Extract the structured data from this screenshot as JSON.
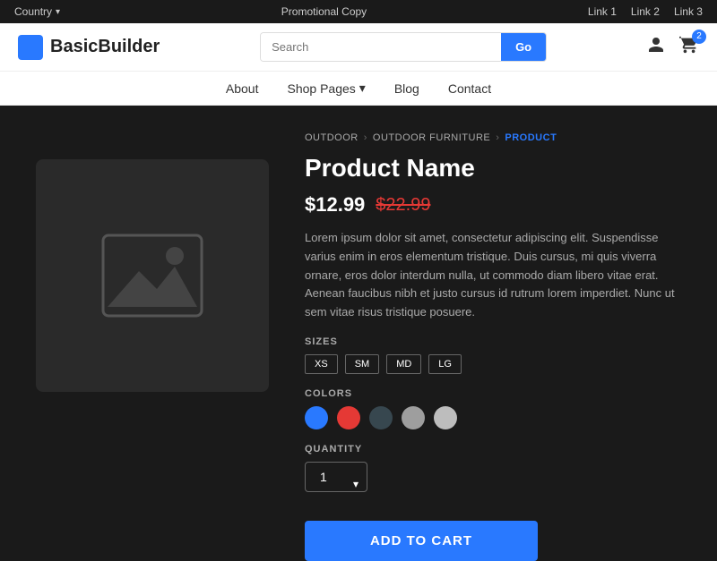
{
  "topbar": {
    "country": "Country",
    "promo": "Promotional Copy",
    "links": [
      "Link 1",
      "Link 2",
      "Link 3"
    ]
  },
  "header": {
    "logo_text": "BasicBuilder",
    "search_placeholder": "Search",
    "search_button": "Go",
    "cart_count": "2"
  },
  "nav": {
    "items": [
      {
        "label": "About",
        "dropdown": false
      },
      {
        "label": "Shop Pages",
        "dropdown": true
      },
      {
        "label": "Blog",
        "dropdown": false
      },
      {
        "label": "Contact",
        "dropdown": false
      }
    ]
  },
  "breadcrumb": {
    "items": [
      "OUTDOOR",
      "OUTDOOR FURNITURE",
      "PRODUCT"
    ]
  },
  "product": {
    "name": "Product Name",
    "price_current": "$12.99",
    "price_original": "$22.99",
    "description": "Lorem ipsum dolor sit amet, consectetur adipiscing elit. Suspendisse varius enim in eros elementum tristique. Duis cursus, mi quis viverra ornare, eros dolor interdum nulla, ut commodo diam libero vitae erat. Aenean faucibus nibh et justo cursus id rutrum lorem imperdiet. Nunc ut sem vitae risus tristique posuere.",
    "sizes_label": "SIZES",
    "sizes": [
      "XS",
      "SM",
      "MD",
      "LG"
    ],
    "colors_label": "COLORS",
    "colors": [
      "#2979ff",
      "#e53935",
      "#37474f",
      "#9e9e9e",
      "#bdbdbd"
    ],
    "quantity_label": "QUANTITY",
    "quantity_value": "1",
    "add_to_cart_label": "ADD TO CART"
  }
}
